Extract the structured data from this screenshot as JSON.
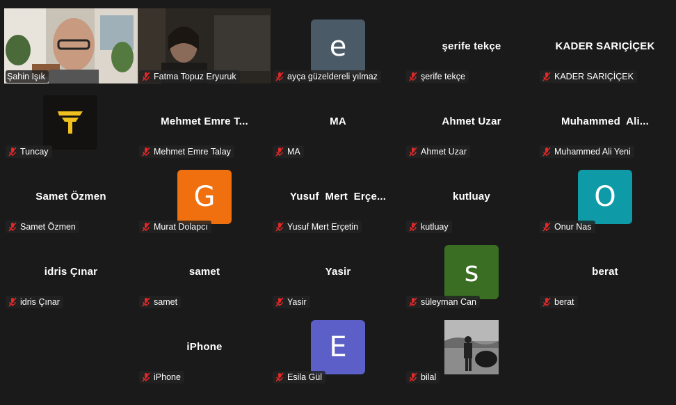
{
  "participants": [
    {
      "label": "Şahin Işık"
    },
    {
      "label": "Fatma Topuz Eryuruk"
    },
    {
      "label": "ayça güzeldereli yılmaz",
      "avatar_letter": "e",
      "avatar_color": "#4a5a66"
    },
    {
      "label": "şerife tekçe",
      "display_name": "şerife tekçe"
    },
    {
      "label": "KADER SARIÇİÇEK",
      "display_name": "KADER SARIÇİÇEK"
    },
    {
      "label": "Tuncay"
    },
    {
      "label": "Mehmet Emre Talay",
      "display_name": "Mehmet Emre T..."
    },
    {
      "label": "MA",
      "display_name": "MA"
    },
    {
      "label": "Ahmet Uzar",
      "display_name": "Ahmet Uzar"
    },
    {
      "label": "Muhammed Ali Yeni",
      "display_name": "Muhammed  Ali..."
    },
    {
      "label": "Samet Özmen",
      "display_name": "Samet Özmen"
    },
    {
      "label": "Murat Dolapcı",
      "avatar_letter": "G",
      "avatar_color": "#f07010"
    },
    {
      "label": "Yusuf Mert Erçetin",
      "display_name": "Yusuf  Mert  Erçe..."
    },
    {
      "label": "kutluay",
      "display_name": "kutluay"
    },
    {
      "label": "Onur Nas",
      "avatar_letter": "O",
      "avatar_color": "#0e9aa7"
    },
    {
      "label": "idris Çınar",
      "display_name": "idris Çınar"
    },
    {
      "label": "samet",
      "display_name": "samet"
    },
    {
      "label": "Yasir",
      "display_name": "Yasir"
    },
    {
      "label": "süleyman Can",
      "avatar_letter": "s",
      "avatar_color": "#3a6e22"
    },
    {
      "label": "berat",
      "display_name": "berat"
    },
    {
      "label": "iPhone",
      "display_name": "iPhone"
    },
    {
      "label": "Esila Gül",
      "avatar_letter": "E",
      "avatar_color": "#5b5fc7"
    },
    {
      "label": "bilal"
    }
  ],
  "colors": {
    "active_border": "#2ee07a",
    "mute_icon": "#e02828",
    "background": "#1a1a1a"
  }
}
